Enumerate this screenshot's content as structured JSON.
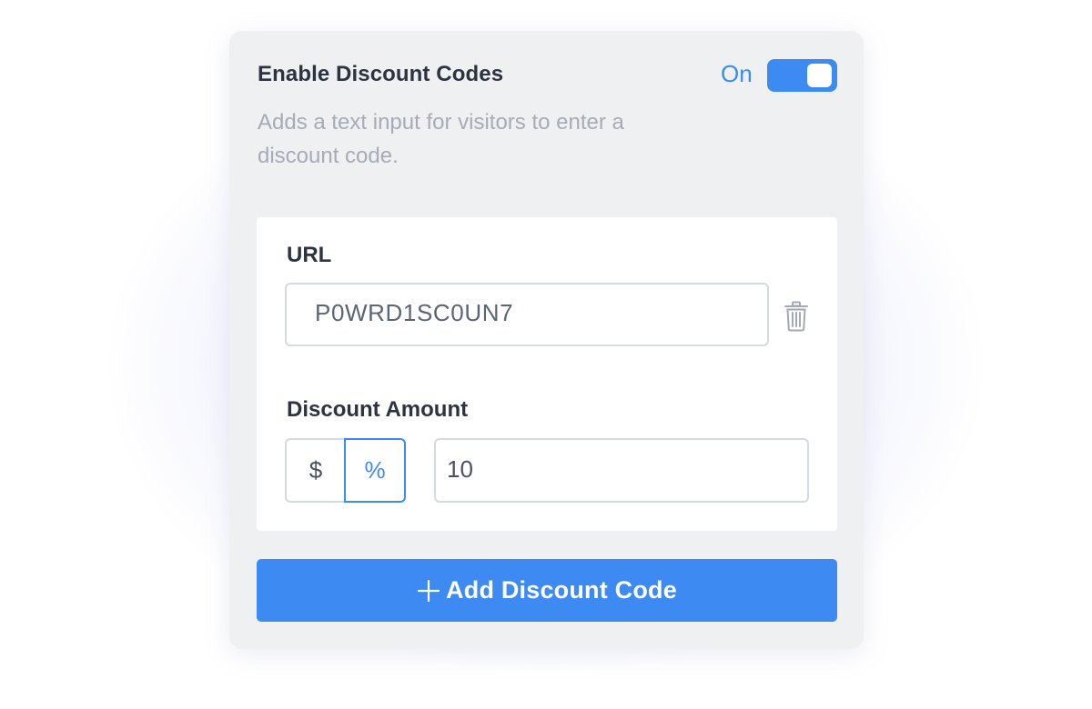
{
  "settings": {
    "title": "Enable Discount Codes",
    "toggle_state": "On",
    "toggle_on": true,
    "description": "Adds a text input for visitors to enter a discount code."
  },
  "discount_code": {
    "url_label": "URL",
    "url_value": "P0WRD1SC0UN7",
    "amount_label": "Discount Amount",
    "unit_options": [
      "$",
      "%"
    ],
    "selected_unit": "%",
    "amount_value": "10",
    "delete_icon": "trash-icon"
  },
  "actions": {
    "add_label": "Add Discount Code",
    "add_icon": "plus-icon"
  },
  "colors": {
    "accent": "#3d8bf2",
    "panel_bg": "#eff0f2",
    "heading": "#2d3440",
    "muted": "#a6abb6"
  }
}
